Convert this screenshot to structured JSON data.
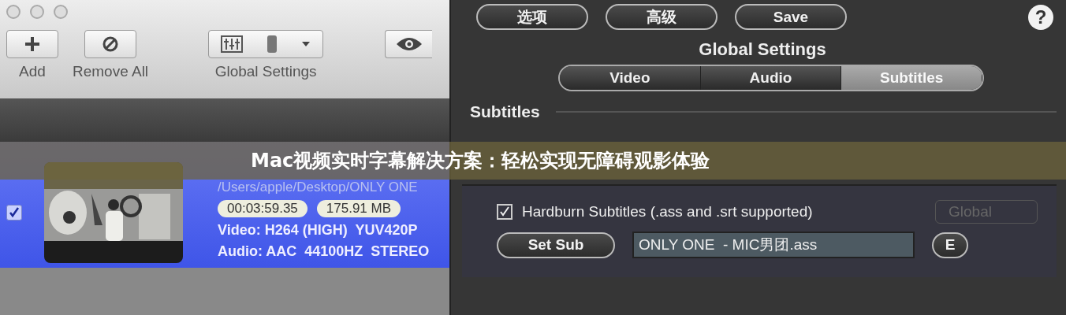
{
  "toolbar": {
    "buttons": [
      {
        "kind": "add",
        "label": "Add"
      },
      {
        "kind": "remove",
        "label": "Remove All"
      }
    ],
    "global_settings": {
      "label": "Global Settings"
    }
  },
  "file_row": {
    "checked": true,
    "path": "/Users/apple/Desktop/ONLY ONE",
    "duration": "00:03:59.35",
    "size": "175.91 MB",
    "video": "Video: H264 (HIGH)  YUV420P",
    "audio": "Audio: AAC  44100HZ  STEREO"
  },
  "panel": {
    "top_buttons": [
      "选项",
      "高级",
      "Save"
    ],
    "help": "?",
    "title": "Global Settings",
    "tabs": [
      {
        "label": "Video",
        "selected": false
      },
      {
        "label": "Audio",
        "selected": false
      },
      {
        "label": "Subtitles",
        "selected": true
      }
    ],
    "section": "Subtitles",
    "hardburn": {
      "label": "Hardburn Subtitles (.ass and .srt supported)",
      "checked": true
    },
    "global_select": "Global",
    "set_sub": "Set Sub",
    "sub_file": "ONLY ONE  - MIC男团.ass",
    "edit_button": "E"
  },
  "banner": "Mac视频实时字幕解决方案：轻松实现无障碍观影体验"
}
